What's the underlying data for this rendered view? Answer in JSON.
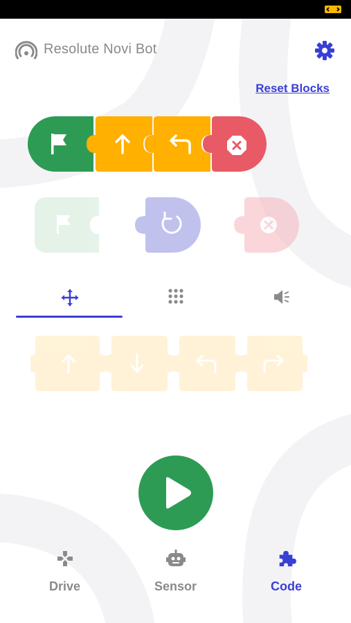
{
  "header": {
    "robot_name": "Resolute Novi Bot"
  },
  "toolbar": {
    "reset_label": "Reset Blocks"
  },
  "program": {
    "blocks": [
      "flag-start",
      "move-forward",
      "turn-left",
      "stop"
    ]
  },
  "palette": {
    "blocks": [
      "flag-start",
      "repeat",
      "stop"
    ],
    "state": "disabled"
  },
  "tabs": {
    "items": [
      "move",
      "grid",
      "sound"
    ],
    "active": "move"
  },
  "move_blocks": [
    "forward",
    "backward",
    "turn-left",
    "turn-right"
  ],
  "nav": {
    "items": [
      {
        "label": "Drive",
        "icon": "gamepad-icon"
      },
      {
        "label": "Sensor",
        "icon": "robot-icon"
      },
      {
        "label": "Code",
        "icon": "puzzle-icon"
      }
    ],
    "active": "Code"
  },
  "colors": {
    "accent": "#3a3fd6",
    "green": "#2e9b55",
    "yellow": "#ffb000",
    "red": "#e85a66",
    "grey_text": "#8a8a8a"
  }
}
